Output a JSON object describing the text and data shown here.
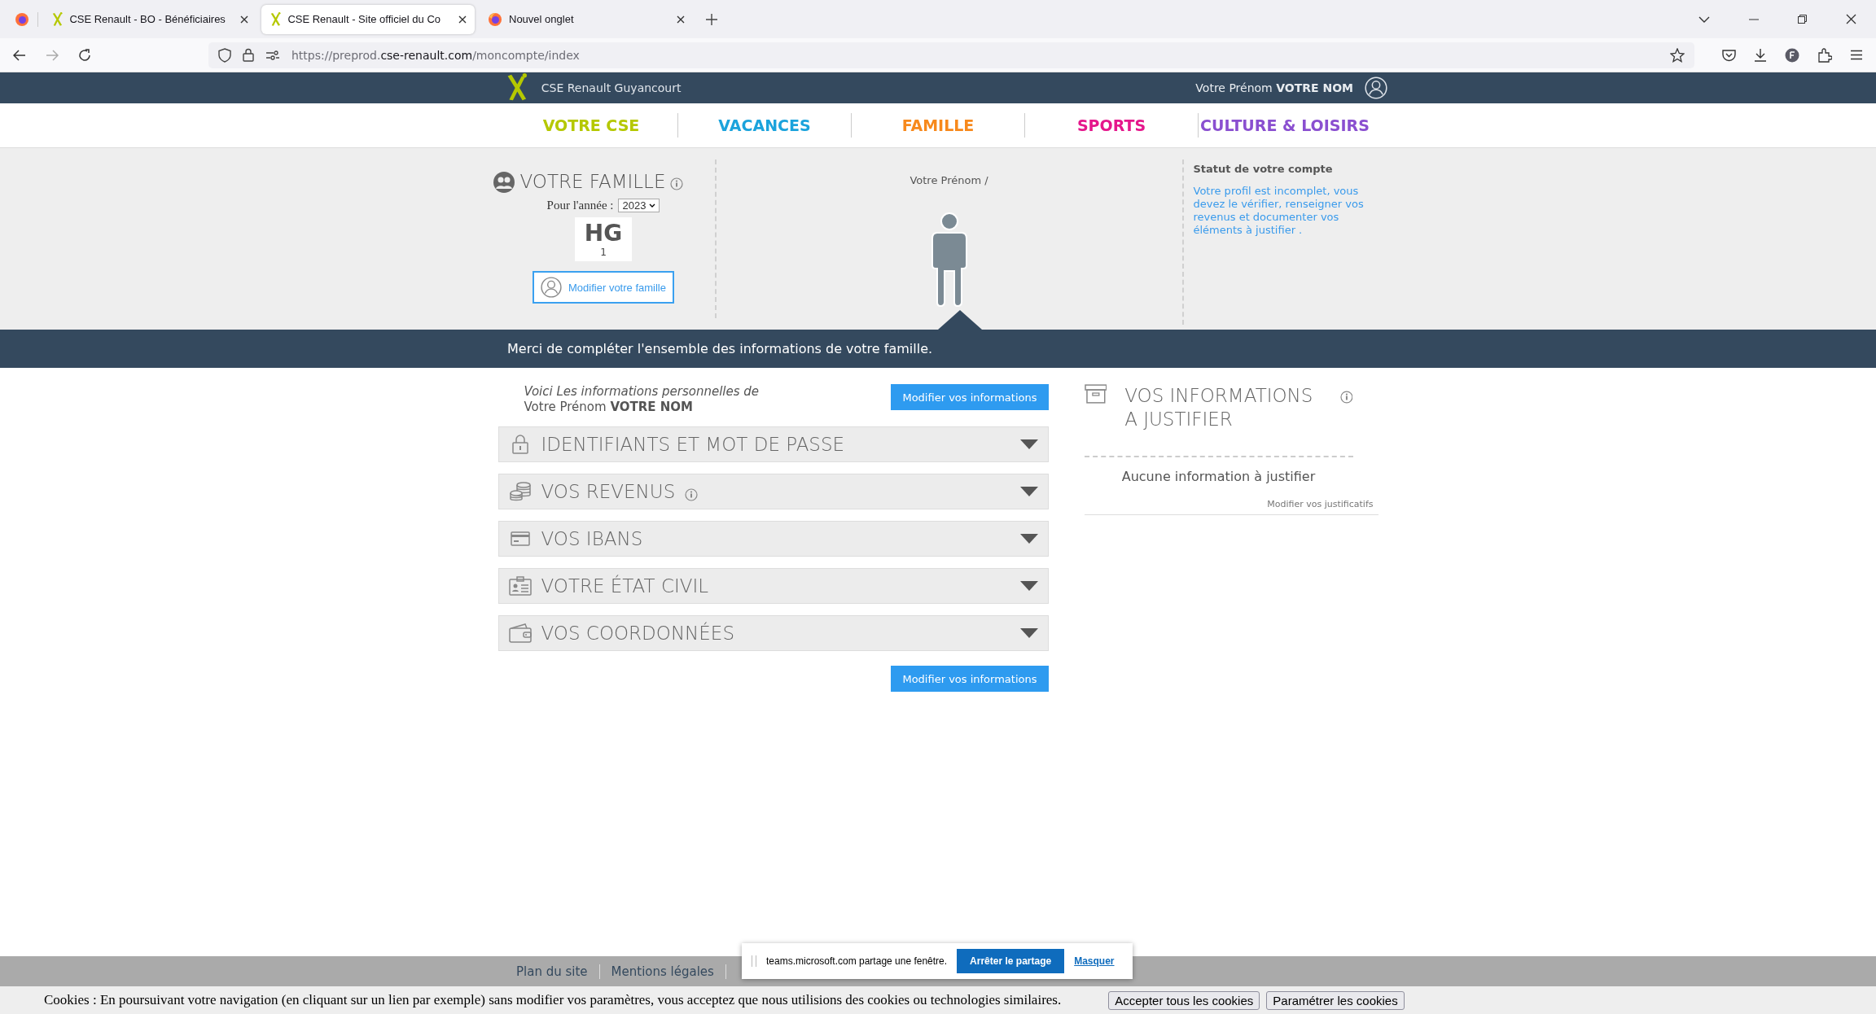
{
  "browser": {
    "tabs": [
      {
        "title": "CSE Renault - BO - Bénéficiaires",
        "kind": "site",
        "selected": false
      },
      {
        "title": "CSE Renault - Site officiel du Co",
        "kind": "site",
        "selected": true
      },
      {
        "title": "Nouvel onglet",
        "kind": "firefox",
        "selected": false
      }
    ],
    "url": {
      "prefix": "https://preprod.",
      "domain": "cse-renault.com",
      "path": "/moncompte/index"
    }
  },
  "header": {
    "brand": "CSE Renault Guyancourt",
    "first_name": "Votre Prénom",
    "last_name": "VOTRE NOM"
  },
  "nav": [
    {
      "label": "VOTRE CSE",
      "color": "#b5c800"
    },
    {
      "label": "VACANCES",
      "color": "#1ba3dc"
    },
    {
      "label": "FAMILLE",
      "color": "#f7891c"
    },
    {
      "label": "SPORTS",
      "color": "#e5178c"
    },
    {
      "label": "CULTURE & LOISIRS",
      "color": "#8a4fd0"
    }
  ],
  "family": {
    "title": "VOTRE FAMILLE",
    "year_label": "Pour l'année :",
    "year": "2023",
    "members": [
      {
        "initials": "HG",
        "count": "1"
      }
    ],
    "button": "Modifier votre famille"
  },
  "profile": {
    "name": "Votre Prénom /"
  },
  "status": {
    "title": "Statut de votre compte",
    "message": "Votre profil est incomplet, vous devez le vérifier, renseigner vos revenus et documenter vos éléments à justifier ."
  },
  "banner": "Merci de compléter l'ensemble des informations de votre famille.",
  "personal": {
    "intro": "Voici Les informations personnelles de",
    "first_name": "Votre Prénom",
    "last_name": "VOTRE NOM",
    "button": "Modifier vos informations",
    "sections": [
      {
        "title": "IDENTIFIANTS ET MOT DE PASSE",
        "kind": "lock",
        "info": false
      },
      {
        "title": "VOS REVENUS",
        "kind": "coins",
        "info": true
      },
      {
        "title": "VOS IBANS",
        "kind": "card",
        "info": false
      },
      {
        "title": "VOTRE ÉTAT CIVIL",
        "kind": "id",
        "info": false
      },
      {
        "title": "VOS COORDONNÉES",
        "kind": "wallet",
        "info": false
      }
    ],
    "bottom_button": "Modifier vos informations"
  },
  "justify": {
    "title": "VOS INFORMATIONS A JUSTIFIER",
    "empty": "Aucune information à justifier",
    "link": "Modifier vos justificatifs"
  },
  "footer": {
    "links": [
      "Plan du site",
      "Mentions légales"
    ]
  },
  "share": {
    "text": "teams.microsoft.com partage une fenêtre.",
    "stop": "Arrêter le partage",
    "hide": "Masquer"
  },
  "cookies": {
    "text": "Cookies : En poursuivant votre navigation (en cliquant sur un lien par exemple) sans modifier vos paramètres, vous acceptez que nous utilisions des cookies ou technologies similaires.",
    "accept": "Accepter tous les cookies",
    "settings": "Paramétrer les cookies"
  }
}
